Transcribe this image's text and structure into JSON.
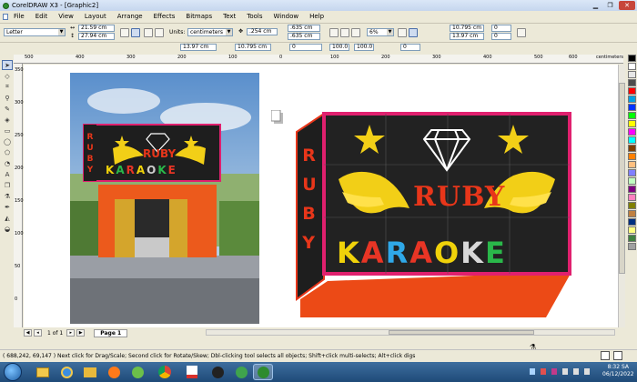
{
  "window": {
    "title": "CorelDRAW X3 - [Graphic2]"
  },
  "menu": [
    "File",
    "Edit",
    "View",
    "Layout",
    "Arrange",
    "Effects",
    "Bitmaps",
    "Text",
    "Tools",
    "Window",
    "Help"
  ],
  "propbar": {
    "paper_size": "Letter",
    "width": "21.59 cm",
    "height": "27.94 cm",
    "units_label": "Units:",
    "units": "centimeters",
    "nudge": ".254 cm",
    "dup_x": ".635 cm",
    "dup_y": ".635 cm",
    "zoom": "6%",
    "obj_x": "10.795 cm",
    "obj_y": "13.97 cm",
    "obj_w": "0",
    "obj_h": "0",
    "scale_x": "100.0",
    "scale_y": "100.0",
    "angle": "0",
    "pos_x2": "10.795 cm",
    "pos_y2": "13.97 cm",
    "dim_a": "0",
    "dim_b": "0"
  },
  "rulers": {
    "top_ticks": [
      "500",
      "400",
      "300",
      "200",
      "100",
      "0",
      "100",
      "200",
      "300",
      "400",
      "500",
      "600"
    ],
    "top_unit": "centimeters",
    "left_ticks": [
      "350",
      "300",
      "250",
      "200",
      "150",
      "100",
      "50",
      "0"
    ],
    "left_unit": "centimeters"
  },
  "artwork": {
    "side_text": "RUBY",
    "ruby": "RUBY",
    "karaoke_letters": [
      {
        "ch": "K",
        "color": "#f0d20a"
      },
      {
        "ch": "A",
        "color": "#e83525"
      },
      {
        "ch": "R",
        "color": "#2fa8e8"
      },
      {
        "ch": "A",
        "color": "#e83525"
      },
      {
        "ch": "O",
        "color": "#f0d20a"
      },
      {
        "ch": "K",
        "color": "#d8d8d8"
      },
      {
        "ch": "E",
        "color": "#2ab84a"
      }
    ],
    "karaoke_alt_colors": [
      "#f0d20a",
      "#2ab84a",
      "#e83525",
      "#f0d20a",
      "#cccccc",
      "#2ab84a",
      "#e83525"
    ],
    "accent": "#e8361a",
    "frame_pink": "#e0206e",
    "star_color": "#f2cf17"
  },
  "pagenav": {
    "position": "1 of 1",
    "page_tab": "Page 1"
  },
  "status": {
    "coords": "( 688,242, 69,147 )",
    "hint": "Next click for Drag/Scale; Second click for Rotate/Skew; Dbl-clicking tool selects all objects; Shift+click multi-selects; Alt+click digs"
  },
  "taskbar": {
    "time": "8:32 SA",
    "date": "06/12/2022"
  },
  "palette_colors": [
    "#000000",
    "#ffffff",
    "#e6e6e6",
    "#4d4d4d",
    "#ff0000",
    "#00a0e3",
    "#0033ff",
    "#00ff00",
    "#ffff00",
    "#ff00ff",
    "#00ffff",
    "#7f3f00",
    "#ff8000",
    "#ffc080",
    "#8080ff",
    "#c0ffc0",
    "#800080",
    "#ff80c0",
    "#808000",
    "#c08040",
    "#003080",
    "#ffff80",
    "#408040",
    "#a0a0a0"
  ]
}
